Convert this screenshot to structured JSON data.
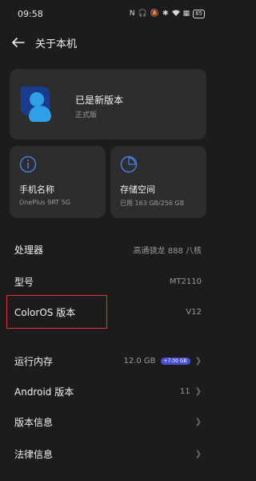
{
  "status_bar": {
    "time": "09:58",
    "icons": [
      "nfc-icon",
      "headset-icon",
      "mute-icon",
      "bluetooth-icon",
      "wifi-icon",
      "sim-icon"
    ],
    "battery": "85"
  },
  "topbar": {
    "title": "关于本机"
  },
  "version_card": {
    "title": "已是新版本",
    "subtitle": "正式版"
  },
  "phone_card": {
    "title": "手机名称",
    "value": "OnePlus 9RT 5G"
  },
  "storage_card": {
    "title": "存储空间",
    "value": "已用 163 GB/256 GB"
  },
  "rows": [
    {
      "label": "处理器",
      "value": "高通骁龙 888 八核"
    },
    {
      "label": "型号",
      "value": "MT2110"
    },
    {
      "label": "ColorOS 版本",
      "value": "V12"
    },
    {
      "label": "运行内存",
      "value": "12.0 GB",
      "badge": "+7.00 GB"
    },
    {
      "label": "Android 版本",
      "value": "11"
    },
    {
      "label": "版本信息",
      "value": ""
    },
    {
      "label": "法律信息",
      "value": ""
    }
  ],
  "colors": {
    "background": "#1c1c1e",
    "card": "#2d2d30",
    "accent": "#4a4fd1",
    "highlight": "#e8322c",
    "logo_dark": "#1b3c8c",
    "logo_light": "#2fa0e6"
  }
}
